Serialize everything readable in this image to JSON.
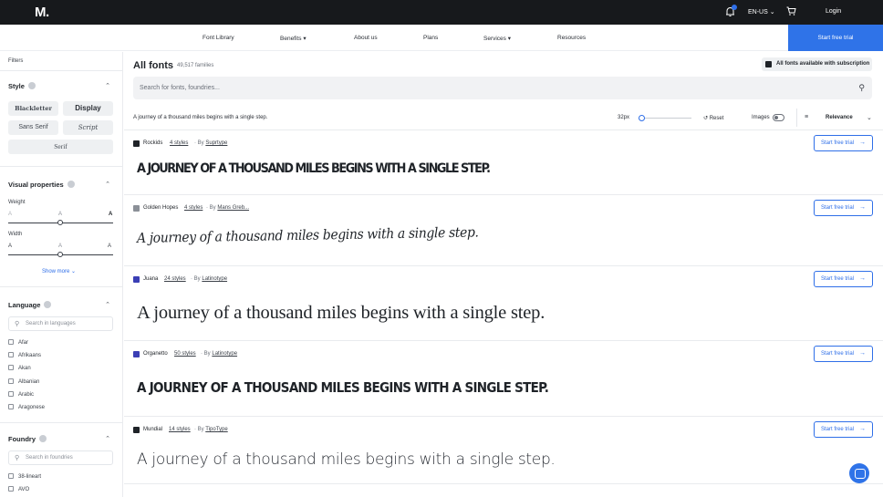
{
  "topbar": {
    "logo": "M.",
    "language": "EN-US",
    "login": "Login"
  },
  "nav": {
    "items": [
      "Font Library",
      "Benefits",
      "About us",
      "Plans",
      "Services",
      "Resources"
    ],
    "trial": "Start free trial"
  },
  "sidebar": {
    "filters": "Filters",
    "style_title": "Style",
    "styles": [
      "Blackletter",
      "Display",
      "Sans Serif",
      "Script",
      "Serif"
    ],
    "visual_title": "Visual properties",
    "weight_label": "Weight",
    "width_label": "Width",
    "axis_letter": "A",
    "show_more": "Show more",
    "language_title": "Language",
    "language_search_placeholder": "Search in languages",
    "languages": [
      "Afar",
      "Afrikaans",
      "Akan",
      "Albanian",
      "Arabic",
      "Aragonese"
    ],
    "foundry_title": "Foundry",
    "foundry_search_placeholder": "Search in foundries",
    "foundries": [
      "38-lineart",
      "AVO"
    ]
  },
  "main": {
    "title": "All fonts",
    "count": "49,517 families",
    "subscription_badge": "All fonts available with subscription",
    "search_placeholder": "Search for fonts, foundries...",
    "sample_text": "A journey of a thousand miles begins with a single step.",
    "size": "32px",
    "reset": "Reset",
    "images": "Images",
    "sort": "Relevance",
    "trial_label": "Start free trial",
    "fonts": [
      {
        "name": "Rockids",
        "styles": "4 styles",
        "by": "By",
        "foundry": "Suprtype",
        "sample": "A JOURNEY OF A THOUSAND MILES BEGINS WITH A SINGLE STEP.",
        "icon_color": "#1f2328"
      },
      {
        "name": "Golden Hopes",
        "styles": "4 styles",
        "by": "By",
        "foundry": "Mans Greb...",
        "sample": "A journey of a thousand miles begins with a single step.",
        "icon_color": "#8b9098"
      },
      {
        "name": "Juana",
        "styles": "24 styles",
        "by": "By",
        "foundry": "Latinotype",
        "sample": "A journey of a thousand miles begins with a single step.",
        "icon_color": "#3b3fb5"
      },
      {
        "name": "Organetto",
        "styles": "50 styles",
        "by": "By",
        "foundry": "Latinotype",
        "sample": "A JOURNEY OF A THOUSAND MILES BEGINS WITH A SINGLE STEP.",
        "icon_color": "#3b3fb5"
      },
      {
        "name": "Mundial",
        "styles": "14 styles",
        "by": "By",
        "foundry": "TipoType",
        "sample": "A journey of a thousand miles begins with a single step.",
        "icon_color": "#1f2328"
      }
    ]
  }
}
